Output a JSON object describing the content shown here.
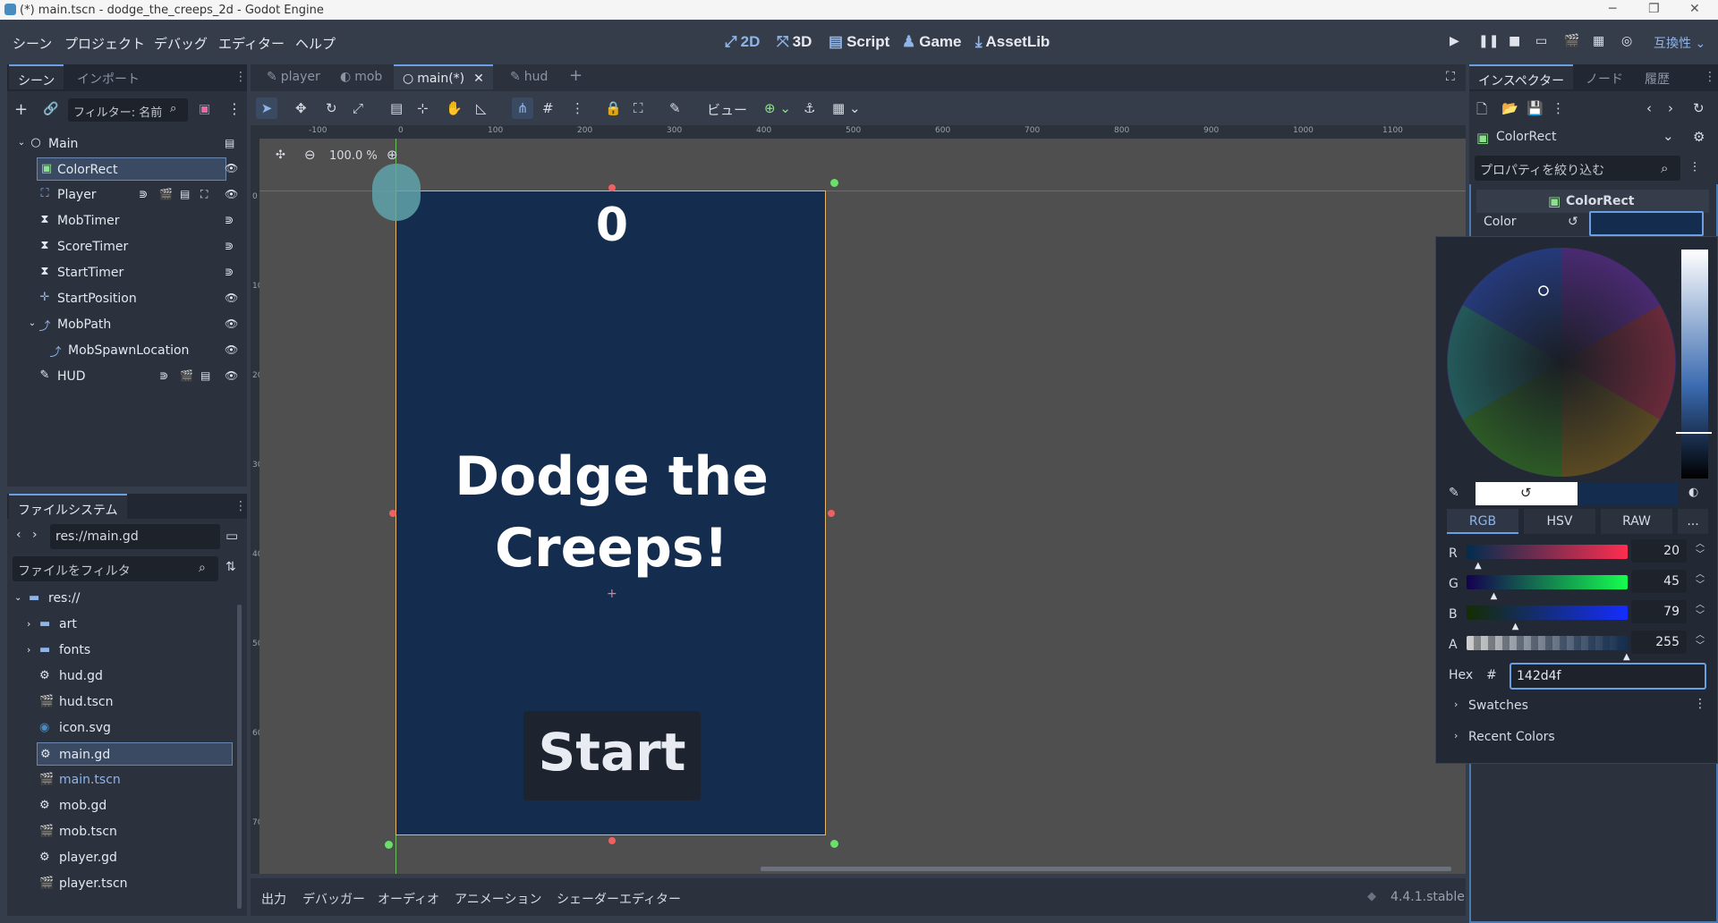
{
  "titlebar": {
    "title": "(*) main.tscn - dodge_the_creeps_2d - Godot Engine"
  },
  "menu": [
    "シーン",
    "プロジェクト",
    "デバッグ",
    "エディター",
    "ヘルプ"
  ],
  "workspaces": [
    {
      "label": "2D",
      "icon": "2d-icon"
    },
    {
      "label": "3D",
      "icon": "3d-icon"
    },
    {
      "label": "Script",
      "icon": "script-icon"
    },
    {
      "label": "Game",
      "icon": "game-icon"
    },
    {
      "label": "AssetLib",
      "icon": "assetlib-icon"
    }
  ],
  "renderer": "互換性",
  "scene_dock": {
    "tabs": [
      "シーン",
      "インポート"
    ],
    "filter_placeholder": "フィルター: 名前",
    "nodes": [
      {
        "name": "Main",
        "icon": "node2d-icon"
      },
      {
        "name": "ColorRect",
        "icon": "colorrect-icon"
      },
      {
        "name": "Player",
        "icon": "area2d-icon"
      },
      {
        "name": "MobTimer",
        "icon": "timer-icon"
      },
      {
        "name": "ScoreTimer",
        "icon": "timer-icon"
      },
      {
        "name": "StartTimer",
        "icon": "timer-icon"
      },
      {
        "name": "StartPosition",
        "icon": "marker2d-icon"
      },
      {
        "name": "MobPath",
        "icon": "path2d-icon"
      },
      {
        "name": "MobSpawnLocation",
        "icon": "pathfollow2d-icon"
      },
      {
        "name": "HUD",
        "icon": "canvaslayer-icon"
      }
    ]
  },
  "filesystem": {
    "tab": "ファイルシステム",
    "path": "res://main.gd",
    "filter_placeholder": "ファイルをフィルタ",
    "items": [
      {
        "name": "res://",
        "type": "folder"
      },
      {
        "name": "art",
        "type": "folder"
      },
      {
        "name": "fonts",
        "type": "folder"
      },
      {
        "name": "hud.gd",
        "type": "script"
      },
      {
        "name": "hud.tscn",
        "type": "scene"
      },
      {
        "name": "icon.svg",
        "type": "image"
      },
      {
        "name": "main.gd",
        "type": "script"
      },
      {
        "name": "main.tscn",
        "type": "scene"
      },
      {
        "name": "mob.gd",
        "type": "script"
      },
      {
        "name": "mob.tscn",
        "type": "scene"
      },
      {
        "name": "player.gd",
        "type": "script"
      },
      {
        "name": "player.tscn",
        "type": "scene"
      }
    ]
  },
  "editor_tabs": [
    "player",
    "mob",
    "main(*)",
    "hud"
  ],
  "toolbar": {
    "view_label": "ビュー"
  },
  "viewport": {
    "zoom": "100.0 %",
    "score": "0",
    "title_line1": "Dodge the",
    "title_line2": "Creeps!",
    "start": "Start",
    "ruler_h": [
      "-100",
      "0",
      "100",
      "200",
      "300",
      "400",
      "500",
      "600",
      "700",
      "800",
      "900",
      "1000",
      "1100"
    ],
    "ruler_v": [
      "0",
      "100",
      "200",
      "300",
      "400",
      "500",
      "600",
      "700"
    ]
  },
  "bottom_tabs": [
    "出力",
    "デバッガー",
    "オーディオ",
    "アニメーション",
    "シェーダーエディター"
  ],
  "version": "4.4.1.stable",
  "inspector": {
    "tabs": [
      "インスペクター",
      "ノード",
      "履歴"
    ],
    "node": "ColorRect",
    "filter_placeholder": "プロパティを絞り込む",
    "section": "ColorRect",
    "property": "Color"
  },
  "color_picker": {
    "modes": [
      "RGB",
      "HSV",
      "RAW"
    ],
    "more": "...",
    "channels": [
      {
        "name": "R",
        "value": "20",
        "fraction": 0.078
      },
      {
        "name": "G",
        "value": "45",
        "fraction": 0.176
      },
      {
        "name": "B",
        "value": "79",
        "fraction": 0.31
      },
      {
        "name": "A",
        "value": "255",
        "fraction": 1.0
      }
    ],
    "hex_label": "Hex",
    "hash": "#",
    "hex": "142d4f",
    "swatches": "Swatches",
    "recent": "Recent Colors",
    "colors": {
      "current": "#142d4f",
      "accent": "#6a9fe4"
    }
  }
}
